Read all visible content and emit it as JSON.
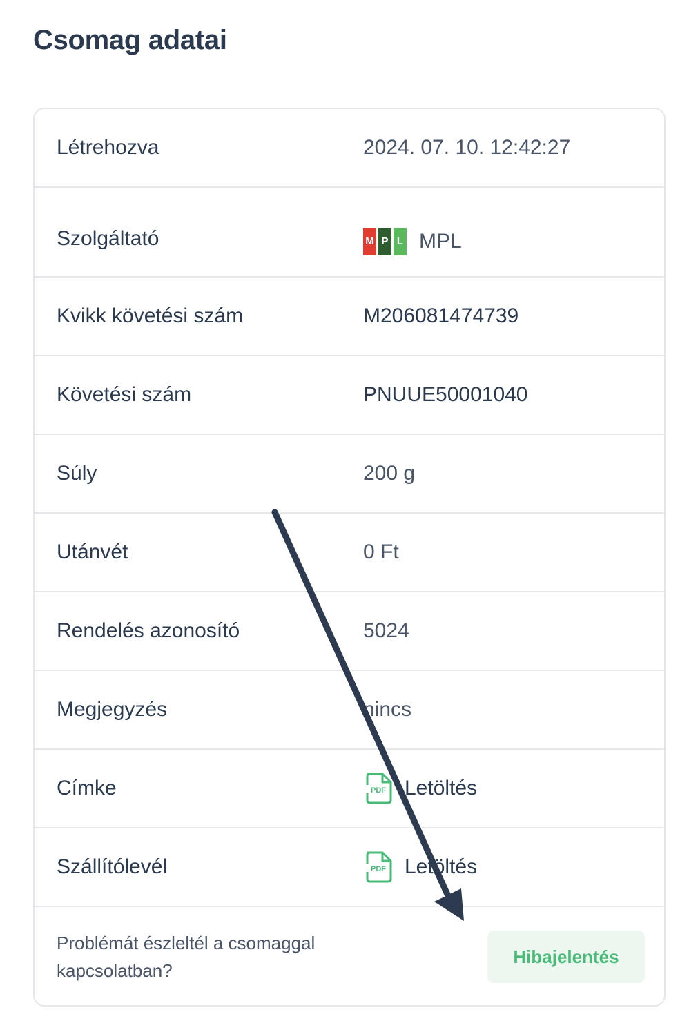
{
  "page": {
    "title": "Csomag adatai"
  },
  "details": {
    "created": {
      "label": "Létrehozva",
      "value": "2024. 07. 10. 12:42:27"
    },
    "provider": {
      "label": "Szolgáltató",
      "value": "MPL",
      "logo_letters": [
        "M",
        "P",
        "L"
      ],
      "logo_colors": [
        "#e03c31",
        "#2f5d2f",
        "#5cb85c"
      ]
    },
    "kvikk_tracking": {
      "label": "Kvikk követési szám",
      "value": "M206081474739"
    },
    "tracking": {
      "label": "Követési szám",
      "value": "PNUUE50001040"
    },
    "weight": {
      "label": "Súly",
      "value": "200 g"
    },
    "cod": {
      "label": "Utánvét",
      "value": "0 Ft"
    },
    "order_id": {
      "label": "Rendelés azonosító",
      "value": "5024"
    },
    "note": {
      "label": "Megjegyzés",
      "value": "nincs"
    },
    "label_doc": {
      "label": "Címke",
      "link": "Letöltés",
      "icon": "pdf-icon",
      "icon_text": "PDF"
    },
    "delivery_note": {
      "label": "Szállítólevél",
      "link": "Letöltés",
      "icon": "pdf-icon",
      "icon_text": "PDF"
    }
  },
  "footer": {
    "question": "Problémát észleltél a csomaggal kapcsolatban?",
    "report_button": "Hibajelentés"
  },
  "colors": {
    "accent_green": "#48bb78",
    "button_bg": "#edf7f0",
    "arrow": "#2d3a4f"
  }
}
